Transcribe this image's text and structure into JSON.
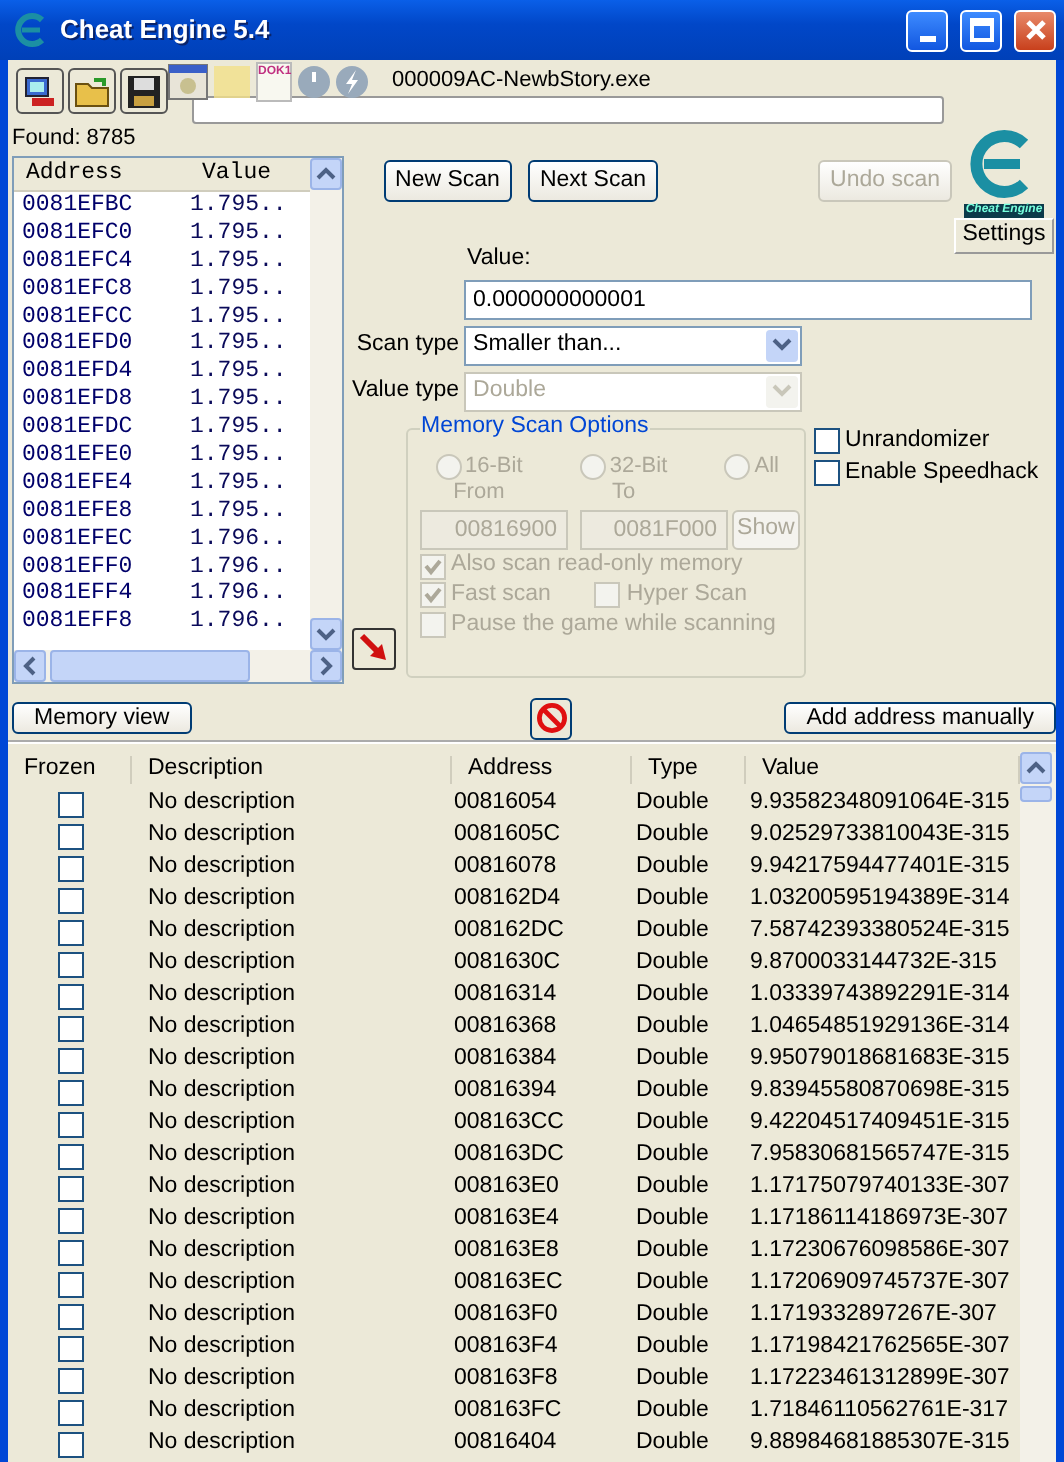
{
  "window": {
    "title": "Cheat Engine 5.4"
  },
  "overlay": {
    "doc_label": "DOK1"
  },
  "process": "000009AC-NewbStory.exe",
  "scan_progress": {
    "level": 0
  },
  "found": "Found: 8785",
  "results": {
    "columns": [
      "Address",
      "Value"
    ],
    "rows": [
      {
        "address": "0081EFBC",
        "value": "1.795.."
      },
      {
        "address": "0081EFC0",
        "value": "1.795.."
      },
      {
        "address": "0081EFC4",
        "value": "1.795.."
      },
      {
        "address": "0081EFC8",
        "value": "1.795.."
      },
      {
        "address": "0081EFCC",
        "value": "1.795.."
      },
      {
        "address": "0081EFD0",
        "value": "1.795.."
      },
      {
        "address": "0081EFD4",
        "value": "1.795.."
      },
      {
        "address": "0081EFD8",
        "value": "1.795.."
      },
      {
        "address": "0081EFDC",
        "value": "1.795.."
      },
      {
        "address": "0081EFE0",
        "value": "1.795.."
      },
      {
        "address": "0081EFE4",
        "value": "1.795.."
      },
      {
        "address": "0081EFE8",
        "value": "1.795.."
      },
      {
        "address": "0081EFEC",
        "value": "1.796.."
      },
      {
        "address": "0081EFF0",
        "value": "1.796.."
      },
      {
        "address": "0081EFF4",
        "value": "1.796.."
      },
      {
        "address": "0081EFF8",
        "value": "1.796.."
      }
    ]
  },
  "buttons": [
    {
      "label": "New Scan",
      "disabled": false
    },
    {
      "label": "Next Scan",
      "disabled": false
    },
    {
      "label": "Undo scan",
      "disabled": true
    }
  ],
  "logo_caption": "Cheat Engine",
  "settings": "Settings",
  "value": {
    "label": "Value:",
    "value": "0.000000000001"
  },
  "scan_type": {
    "label": "Scan type",
    "value": "Smaller than...",
    "disabled": false
  },
  "value_type": {
    "label": "Value type",
    "value": "Double",
    "disabled": true
  },
  "memory_options": {
    "title": "Memory Scan Options",
    "disabled": true,
    "radios": [
      {
        "label": "16-Bit",
        "selected": false
      },
      {
        "label": "32-Bit",
        "selected": false
      },
      {
        "label": "All",
        "selected": false
      }
    ],
    "from": {
      "label": "From",
      "value": "00816900"
    },
    "to": {
      "label": "To",
      "value": "0081F000"
    },
    "show": "Show",
    "check_rows": [
      [
        {
          "label": "Also scan read-only memory",
          "checked": true
        }
      ],
      [
        {
          "label": "Fast scan",
          "checked": true
        },
        {
          "label": "Hyper Scan",
          "checked": false
        }
      ],
      [
        {
          "label": "Pause the game while scanning",
          "checked": false
        }
      ]
    ]
  },
  "options": [
    {
      "label": "Unrandomizer",
      "checked": false
    },
    {
      "label": "Enable Speedhack",
      "checked": false
    }
  ],
  "memory_view": "Memory view",
  "add_address": "Add address manually",
  "table": {
    "columns": [
      "Frozen",
      "Description",
      "Address",
      "Type",
      "Value"
    ],
    "rows": [
      {
        "frozen": false,
        "description": "No description",
        "address": "00816054",
        "type": "Double",
        "value": "9.93582348091064E-315"
      },
      {
        "frozen": false,
        "description": "No description",
        "address": "0081605C",
        "type": "Double",
        "value": "9.02529733810043E-315"
      },
      {
        "frozen": false,
        "description": "No description",
        "address": "00816078",
        "type": "Double",
        "value": "9.94217594477401E-315"
      },
      {
        "frozen": false,
        "description": "No description",
        "address": "008162D4",
        "type": "Double",
        "value": "1.03200595194389E-314"
      },
      {
        "frozen": false,
        "description": "No description",
        "address": "008162DC",
        "type": "Double",
        "value": "7.58742393380524E-315"
      },
      {
        "frozen": false,
        "description": "No description",
        "address": "0081630C",
        "type": "Double",
        "value": "9.8700033144732E-315"
      },
      {
        "frozen": false,
        "description": "No description",
        "address": "00816314",
        "type": "Double",
        "value": "1.03339743892291E-314"
      },
      {
        "frozen": false,
        "description": "No description",
        "address": "00816368",
        "type": "Double",
        "value": "1.04654851929136E-314"
      },
      {
        "frozen": false,
        "description": "No description",
        "address": "00816384",
        "type": "Double",
        "value": "9.95079018681683E-315"
      },
      {
        "frozen": false,
        "description": "No description",
        "address": "00816394",
        "type": "Double",
        "value": "9.83945580870698E-315"
      },
      {
        "frozen": false,
        "description": "No description",
        "address": "008163CC",
        "type": "Double",
        "value": "9.42204517409451E-315"
      },
      {
        "frozen": false,
        "description": "No description",
        "address": "008163DC",
        "type": "Double",
        "value": "7.95830681565747E-315"
      },
      {
        "frozen": false,
        "description": "No description",
        "address": "008163E0",
        "type": "Double",
        "value": "1.17175079740133E-307"
      },
      {
        "frozen": false,
        "description": "No description",
        "address": "008163E4",
        "type": "Double",
        "value": "1.17186114186973E-307"
      },
      {
        "frozen": false,
        "description": "No description",
        "address": "008163E8",
        "type": "Double",
        "value": "1.17230676098586E-307"
      },
      {
        "frozen": false,
        "description": "No description",
        "address": "008163EC",
        "type": "Double",
        "value": "1.17206909745737E-307"
      },
      {
        "frozen": false,
        "description": "No description",
        "address": "008163F0",
        "type": "Double",
        "value": "1.1719332897267E-307"
      },
      {
        "frozen": false,
        "description": "No description",
        "address": "008163F4",
        "type": "Double",
        "value": "1.17198421762565E-307"
      },
      {
        "frozen": false,
        "description": "No description",
        "address": "008163F8",
        "type": "Double",
        "value": "1.17223461312899E-307"
      },
      {
        "frozen": false,
        "description": "No description",
        "address": "008163FC",
        "type": "Double",
        "value": "1.71846110562761E-317"
      },
      {
        "frozen": false,
        "description": "No description",
        "address": "00816404",
        "type": "Double",
        "value": "9.88984681885307E-315"
      }
    ]
  }
}
